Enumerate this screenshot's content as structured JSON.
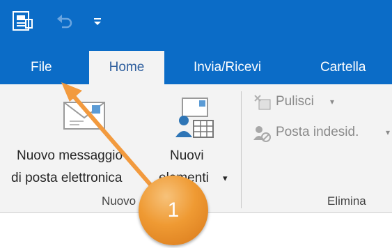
{
  "quick_access": {
    "icons": [
      "outlook-app-icon",
      "undo-icon",
      "customize-dropdown-icon"
    ]
  },
  "tabs": [
    {
      "label": "File",
      "active": false
    },
    {
      "label": "Home",
      "active": true
    },
    {
      "label": "Invia/Ricevi",
      "active": false
    },
    {
      "label": "Cartella",
      "active": false
    }
  ],
  "ribbon": {
    "new_message": {
      "line1": "Nuovo messaggio",
      "line2": "di posta elettronica"
    },
    "new_items": {
      "line1": "Nuovi",
      "line2": "elementi",
      "dropdown": "▾"
    },
    "group_new_label": "Nuovo",
    "clean": {
      "label": "Pulisci",
      "dropdown": "▾"
    },
    "junk": {
      "label": "Posta indesid.",
      "dropdown": "▾"
    },
    "group_delete_label": "Elimina"
  },
  "annotation": {
    "number": "1",
    "color": "#ef9a33"
  },
  "colors": {
    "titlebar": "#0b6cc7",
    "ribbon": "#f3f3f3",
    "active_tab_text": "#2f5f9e"
  }
}
